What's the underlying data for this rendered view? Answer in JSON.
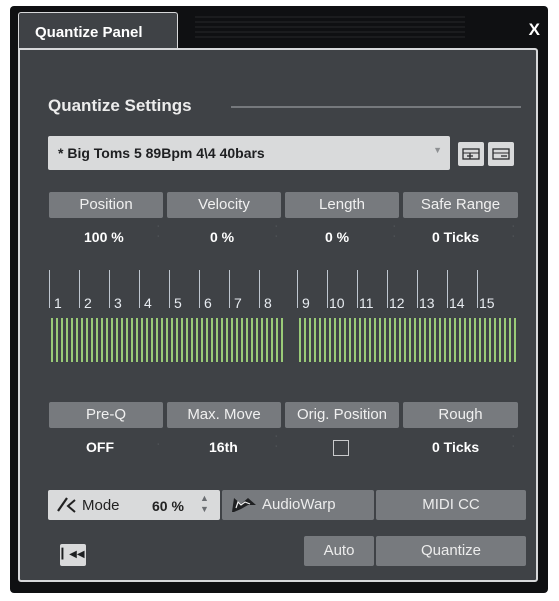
{
  "window": {
    "tab_title": "Quantize Panel",
    "close_label": "X"
  },
  "settings": {
    "title": "Quantize Settings",
    "preset": "* Big Toms 5  89Bpm  4\\4  40bars"
  },
  "params_top": [
    {
      "label": "Position",
      "value": "100 %"
    },
    {
      "label": "Velocity",
      "value": "0 %"
    },
    {
      "label": "Length",
      "value": "0 %"
    },
    {
      "label": "Safe Range",
      "value": "0 Ticks"
    }
  ],
  "grid": {
    "labels": [
      "1",
      "2",
      "3",
      "4",
      "5",
      "6",
      "7",
      "8",
      "9",
      "10",
      "11",
      "12",
      "13",
      "14",
      "15"
    ]
  },
  "params_bottom": [
    {
      "label": "Pre-Q",
      "value": "OFF"
    },
    {
      "label": "Max. Move",
      "value": "16th"
    },
    {
      "label": "Orig. Position",
      "checked": false
    },
    {
      "label": "Rough",
      "value": "0 Ticks"
    }
  ],
  "mode": {
    "label": "Mode",
    "value": "60 %"
  },
  "buttons": {
    "audiowarp": "AudioWarp",
    "midicc": "MIDI CC",
    "auto": "Auto",
    "quantize": "Quantize"
  },
  "icons": {
    "skip_back": "skip-to-start-icon",
    "swing": "swing-mode-icon",
    "audiowarp": "audiowarp-icon"
  },
  "colors": {
    "panel_bg": "#3f4246",
    "button_bg": "#777a7e",
    "grid_green": "#9acb78",
    "light_button": "#d9dadb"
  }
}
